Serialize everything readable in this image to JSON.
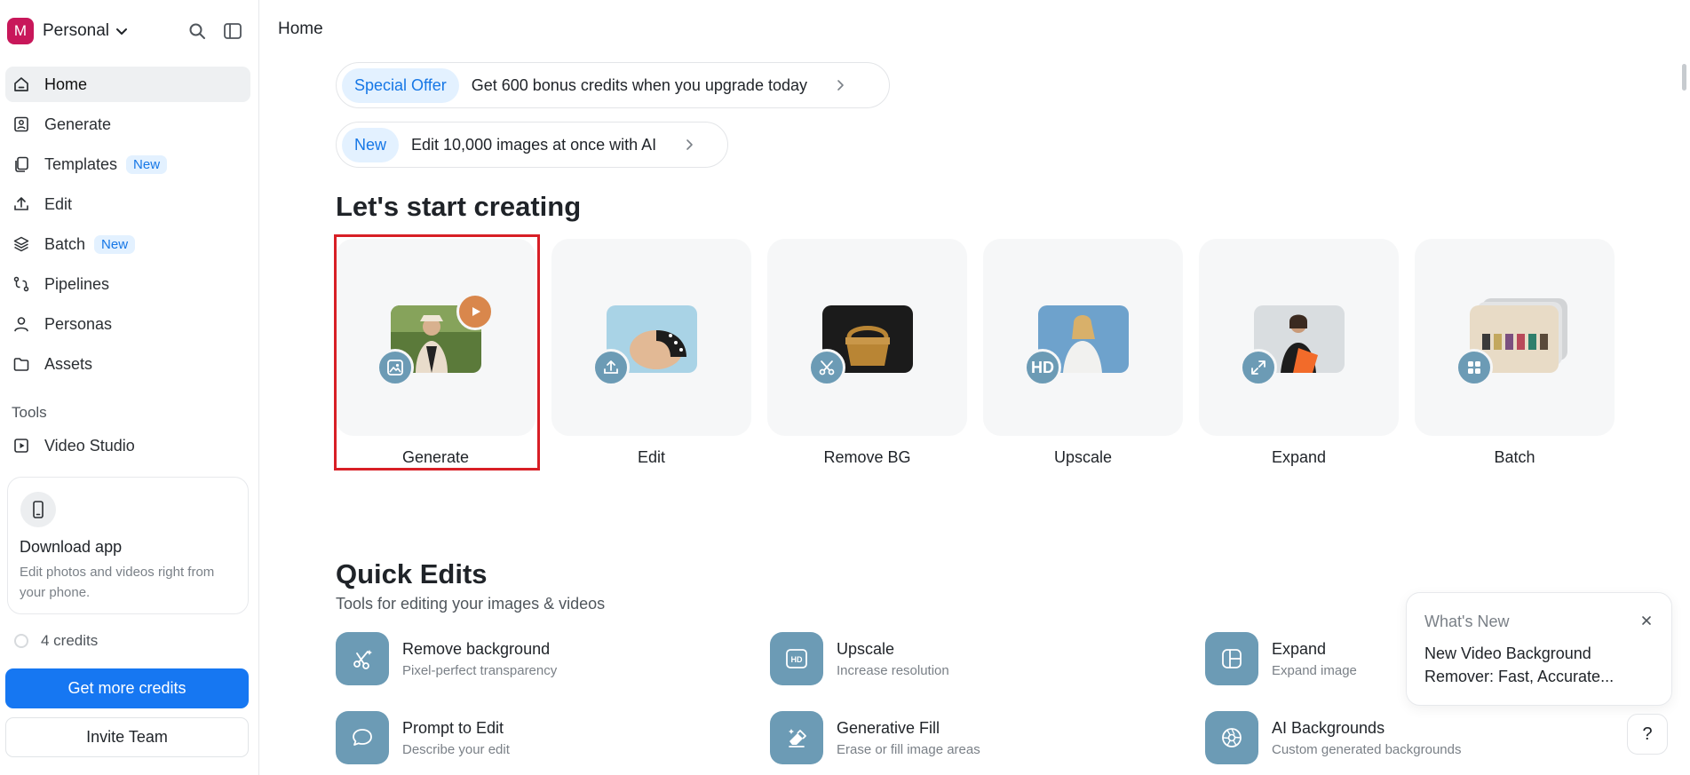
{
  "workspace": {
    "avatar_letter": "M",
    "name": "Personal"
  },
  "breadcrumb": "Home",
  "sidebar": {
    "items": [
      {
        "label": "Home",
        "icon": "home-icon",
        "active": true
      },
      {
        "label": "Generate",
        "icon": "image-generate-icon"
      },
      {
        "label": "Templates",
        "icon": "copy-icon",
        "badge": "New"
      },
      {
        "label": "Edit",
        "icon": "upload-icon"
      },
      {
        "label": "Batch",
        "icon": "layers-icon",
        "badge": "New"
      },
      {
        "label": "Pipelines",
        "icon": "pipeline-icon"
      },
      {
        "label": "Personas",
        "icon": "person-icon"
      },
      {
        "label": "Assets",
        "icon": "folder-icon"
      }
    ],
    "tools_heading": "Tools",
    "tools_items": [
      {
        "label": "Video Studio",
        "icon": "video-play-icon"
      }
    ],
    "download_card": {
      "title": "Download app",
      "subtitle": "Edit photos and videos right from your phone."
    },
    "credits_text": "4 credits",
    "get_credits_label": "Get more credits",
    "invite_label": "Invite Team"
  },
  "banners": [
    {
      "pill": "Special Offer",
      "text": "Get 600 bonus credits when you upgrade today"
    },
    {
      "pill": "New",
      "text": "Edit 10,000 images at once with AI"
    }
  ],
  "start_heading": "Let's start creating",
  "start_cards": [
    {
      "label": "Generate",
      "badge_icon": "image-icon",
      "selected": true
    },
    {
      "label": "Edit",
      "badge_icon": "upload-icon"
    },
    {
      "label": "Remove BG",
      "badge_icon": "scissors-icon"
    },
    {
      "label": "Upscale",
      "badge_text": "HD"
    },
    {
      "label": "Expand",
      "badge_icon": "expand-icon"
    },
    {
      "label": "Batch",
      "badge_icon": "grid-icon"
    }
  ],
  "quick_edits": {
    "heading": "Quick Edits",
    "subtitle": "Tools for editing your images & videos",
    "items": [
      {
        "title": "Remove background",
        "subtitle": "Pixel-perfect transparency",
        "icon": "magic-scissors-icon"
      },
      {
        "title": "Upscale",
        "subtitle": "Increase resolution",
        "icon": "hd-icon"
      },
      {
        "title": "Expand",
        "subtitle": "Expand image",
        "icon": "expand-frame-icon"
      },
      {
        "title": "Prompt to Edit",
        "subtitle": "Describe your edit",
        "icon": "chat-bubble-icon"
      },
      {
        "title": "Generative Fill",
        "subtitle": "Erase or fill image areas",
        "icon": "eraser-icon"
      },
      {
        "title": "AI Backgrounds",
        "subtitle": "Custom generated backgrounds",
        "icon": "aperture-icon"
      }
    ]
  },
  "whats_new": {
    "heading": "What's New",
    "body": "New Video Background Remover: Fast, Accurate..."
  },
  "help_label": "?",
  "colors": {
    "accent": "#1677f2",
    "selection_outline": "#d81f26",
    "tool_icon_bg": "#6c9bb5",
    "avatar": "#c8175a"
  }
}
